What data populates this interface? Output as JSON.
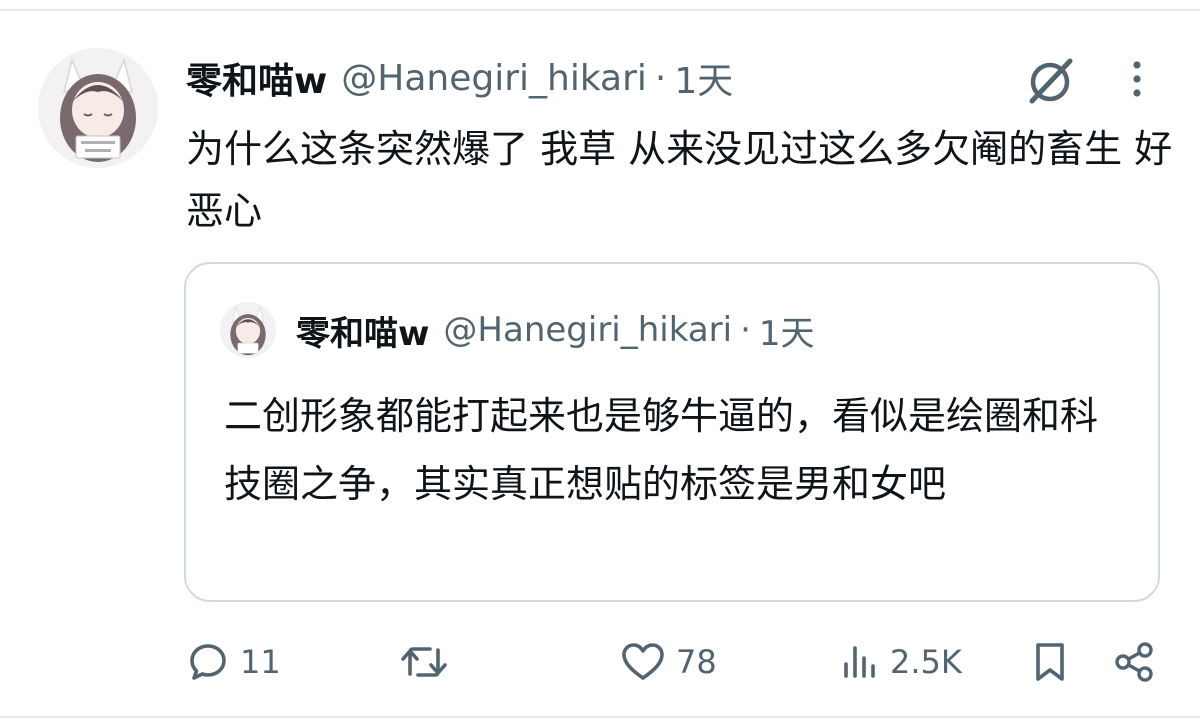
{
  "tweet": {
    "author_name": "零和喵w",
    "handle": "@Hanegiri_hikari",
    "separator": "·",
    "time": "1天",
    "text": "为什么这条突然爆了 我草 从来没见过这么多欠阉的畜生 好恶心"
  },
  "quoted": {
    "author_name": "零和喵w",
    "handle": "@Hanegiri_hikari",
    "separator": "·",
    "time": "1天",
    "text": "二创形象都能打起来也是够牛逼的，看似是绘圈和科技圈之争，其实真正想贴的标签是男和女吧"
  },
  "actions": {
    "replies": "11",
    "likes": "78",
    "views": "2.5K"
  },
  "icons": {
    "grok": "grok-icon",
    "more": "more-vertical-icon",
    "reply": "reply-icon",
    "retweet": "retweet-icon",
    "like": "heart-icon",
    "views": "views-icon",
    "bookmark": "bookmark-icon",
    "share": "share-icon"
  },
  "colors": {
    "text": "#0f1419",
    "secondary": "#536471",
    "border": "#cfd9de"
  }
}
